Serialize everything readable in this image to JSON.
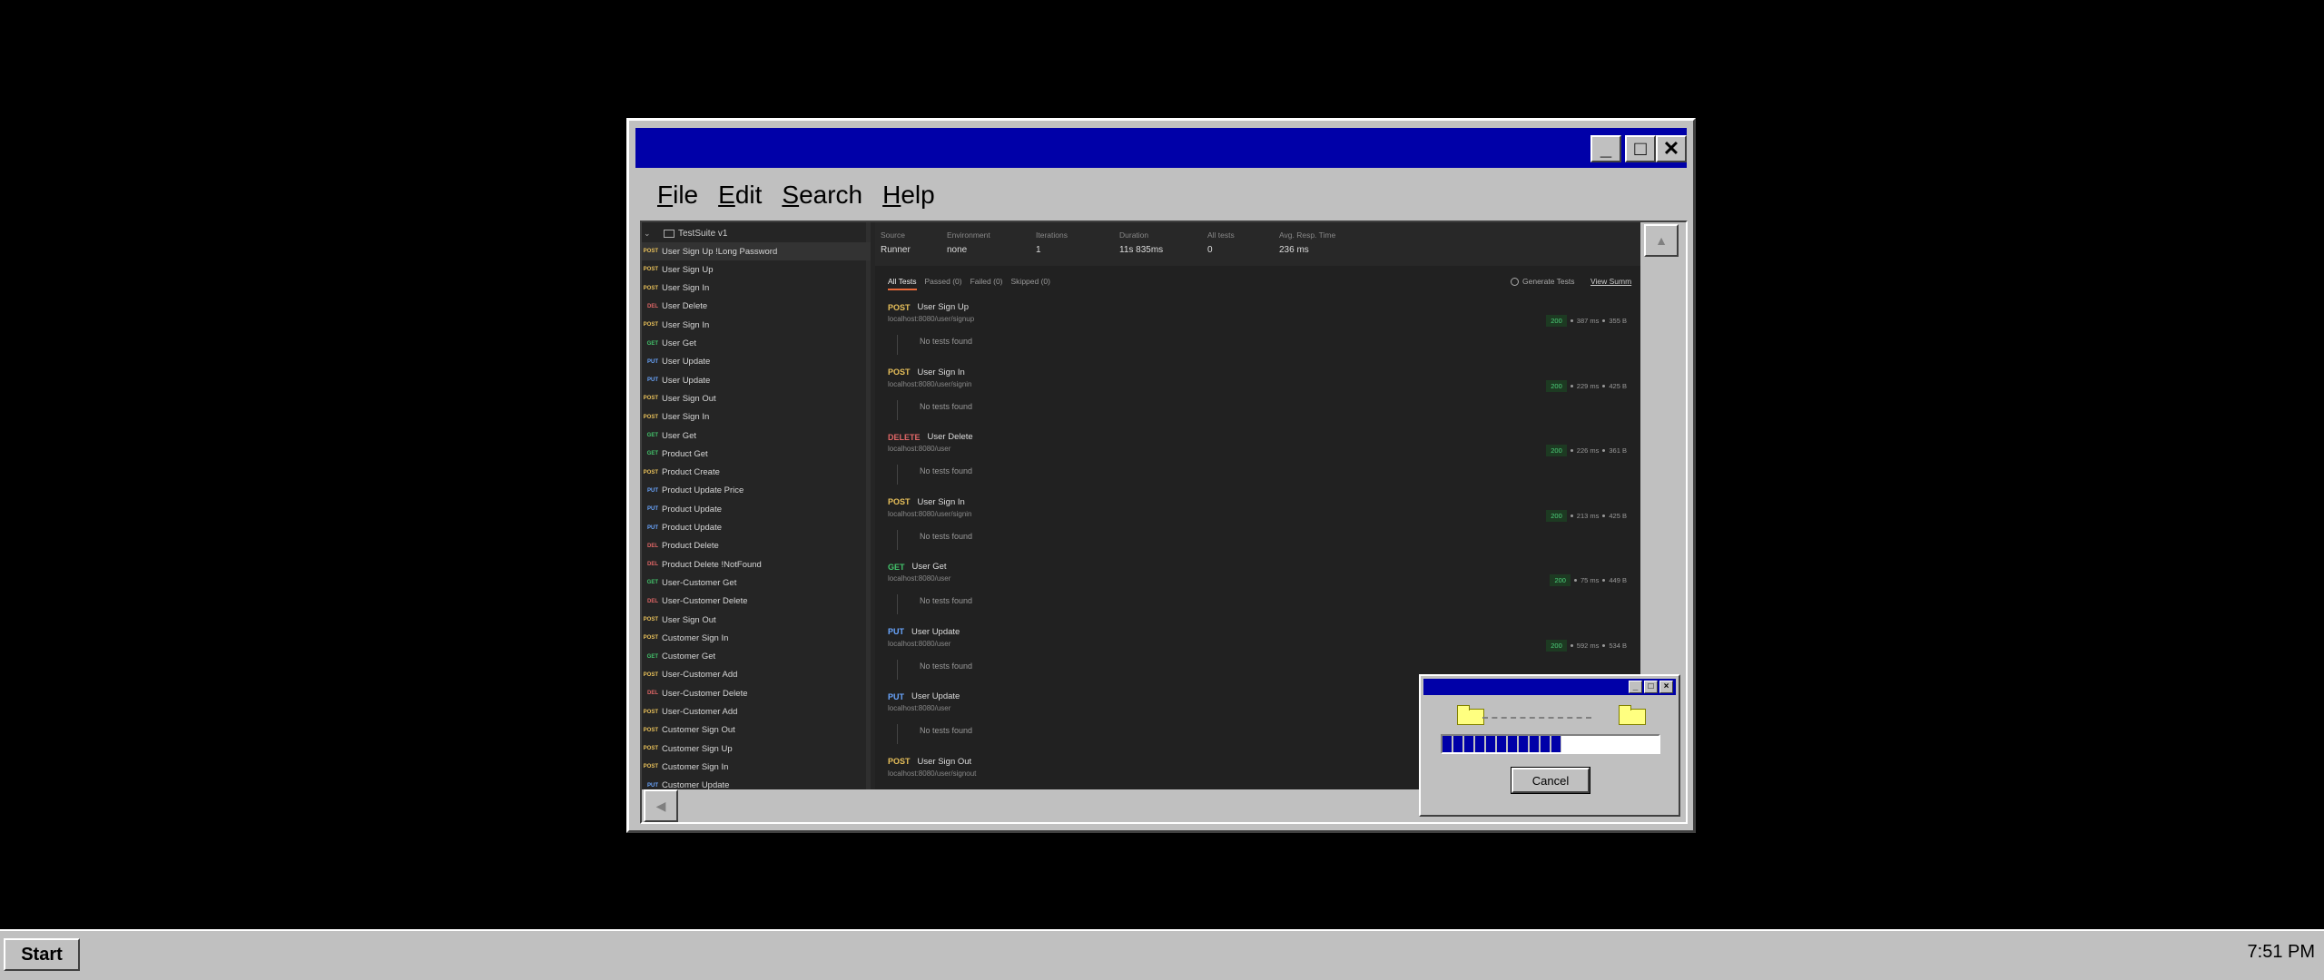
{
  "menu": [
    "File",
    "Edit",
    "Search",
    "Help"
  ],
  "window_buttons": {
    "minimize": "_",
    "maximize": "□",
    "close": "✕"
  },
  "sidebar": {
    "root": "TestSuite v1",
    "items": [
      {
        "method": "POST",
        "name": "User Sign Up !Long Password"
      },
      {
        "method": "POST",
        "name": "User Sign Up"
      },
      {
        "method": "POST",
        "name": "User Sign In"
      },
      {
        "method": "DEL",
        "name": "User Delete"
      },
      {
        "method": "POST",
        "name": "User Sign In"
      },
      {
        "method": "GET",
        "name": "User Get"
      },
      {
        "method": "PUT",
        "name": "User Update"
      },
      {
        "method": "PUT",
        "name": "User Update"
      },
      {
        "method": "POST",
        "name": "User Sign Out"
      },
      {
        "method": "POST",
        "name": "User Sign In"
      },
      {
        "method": "GET",
        "name": "User Get"
      },
      {
        "method": "GET",
        "name": "Product Get"
      },
      {
        "method": "POST",
        "name": "Product Create"
      },
      {
        "method": "PUT",
        "name": "Product Update Price"
      },
      {
        "method": "PUT",
        "name": "Product Update"
      },
      {
        "method": "PUT",
        "name": "Product Update"
      },
      {
        "method": "DEL",
        "name": "Product Delete"
      },
      {
        "method": "DEL",
        "name": "Product Delete !NotFound"
      },
      {
        "method": "GET",
        "name": "User-Customer Get"
      },
      {
        "method": "DEL",
        "name": "User-Customer Delete"
      },
      {
        "method": "POST",
        "name": "User Sign Out"
      },
      {
        "method": "POST",
        "name": "Customer Sign In"
      },
      {
        "method": "GET",
        "name": "Customer Get"
      },
      {
        "method": "POST",
        "name": "User-Customer Add"
      },
      {
        "method": "DEL",
        "name": "User-Customer Delete"
      },
      {
        "method": "POST",
        "name": "User-Customer Add"
      },
      {
        "method": "POST",
        "name": "Customer Sign Out"
      },
      {
        "method": "POST",
        "name": "Customer Sign Up"
      },
      {
        "method": "POST",
        "name": "Customer Sign In"
      },
      {
        "method": "PUT",
        "name": "Customer Update"
      }
    ]
  },
  "stats": [
    {
      "label": "Source",
      "value": "Runner"
    },
    {
      "label": "Environment",
      "value": "none"
    },
    {
      "label": "Iterations",
      "value": "1"
    },
    {
      "label": "Duration",
      "value": "11s 835ms"
    },
    {
      "label": "All tests",
      "value": "0"
    },
    {
      "label": "Avg. Resp. Time",
      "value": "236 ms"
    }
  ],
  "tabs": [
    "All Tests",
    "Passed (0)",
    "Failed (0)",
    "Skipped (0)"
  ],
  "generate_tests": "Generate Tests",
  "view_summary": "View Summ",
  "no_tests": "No tests found",
  "requests": [
    {
      "method": "POST",
      "name": "User Sign Up",
      "url": "localhost:8080/user/signup",
      "code": "200",
      "time": "387 ms",
      "size": "355 B"
    },
    {
      "method": "POST",
      "name": "User Sign In",
      "url": "localhost:8080/user/signin",
      "code": "200",
      "time": "229 ms",
      "size": "425 B"
    },
    {
      "method": "DELETE",
      "name": "User Delete",
      "url": "localhost:8080/user",
      "code": "200",
      "time": "226 ms",
      "size": "361 B"
    },
    {
      "method": "POST",
      "name": "User Sign In",
      "url": "localhost:8080/user/signin",
      "code": "200",
      "time": "213 ms",
      "size": "425 B"
    },
    {
      "method": "GET",
      "name": "User Get",
      "url": "localhost:8080/user",
      "code": "200",
      "time": "75 ms",
      "size": "449 B"
    },
    {
      "method": "PUT",
      "name": "User Update",
      "url": "localhost:8080/user",
      "code": "200",
      "time": "592 ms",
      "size": "534 B"
    },
    {
      "method": "PUT",
      "name": "User Update",
      "url": "localhost:8080/user",
      "code": "",
      "time": "",
      "size": ""
    },
    {
      "method": "POST",
      "name": "User Sign Out",
      "url": "localhost:8080/user/signout",
      "code": "",
      "time": "",
      "size": ""
    }
  ],
  "dialog": {
    "cancel": "Cancel",
    "progress": 0.55
  },
  "taskbar": {
    "start": "Start",
    "clock": "7:51 PM"
  }
}
